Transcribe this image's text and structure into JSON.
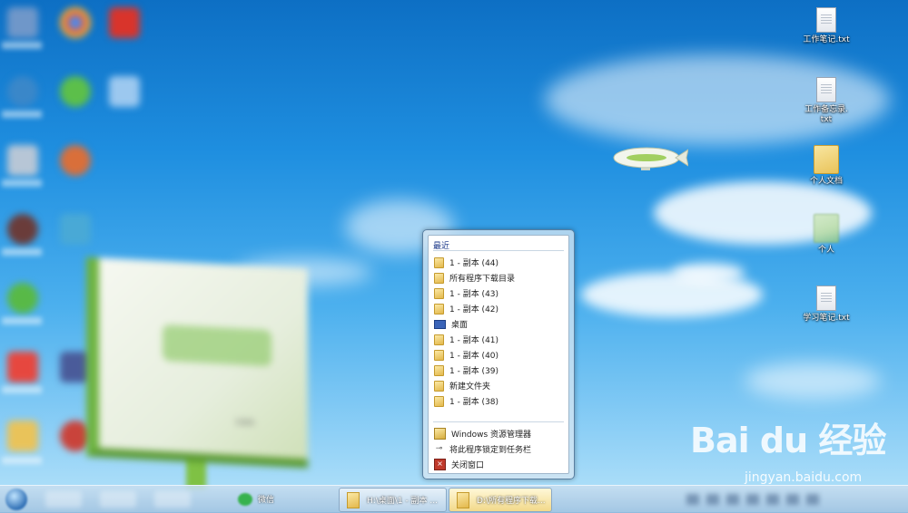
{
  "desktop_icons": [
    {
      "name": "工作笔记.txt",
      "type": "file"
    },
    {
      "name": "工作备忘录.\ntxt",
      "type": "file"
    },
    {
      "name": "个人文档",
      "type": "folder"
    },
    {
      "name": "个人",
      "type": "folder"
    },
    {
      "name": "学习笔记.txt",
      "type": "file"
    }
  ],
  "jumplist": {
    "header": "最近",
    "recent_items": [
      {
        "label": "1 - 副本 (44)",
        "icon": "folder-icon"
      },
      {
        "label": "所有程序下载目录",
        "icon": "folder-icon"
      },
      {
        "label": "1 - 副本 (43)",
        "icon": "folder-icon"
      },
      {
        "label": "1 - 副本 (42)",
        "icon": "folder-icon"
      },
      {
        "label": "桌面",
        "icon": "desktop-icon"
      },
      {
        "label": "1 - 副本 (41)",
        "icon": "folder-icon"
      },
      {
        "label": "1 - 副本 (40)",
        "icon": "folder-icon"
      },
      {
        "label": "1 - 副本 (39)",
        "icon": "folder-icon"
      },
      {
        "label": "新建文件夹",
        "icon": "folder-icon"
      },
      {
        "label": "1 - 副本 (38)",
        "icon": "folder-icon"
      }
    ],
    "tasks": {
      "explorer": "Windows 资源管理器",
      "pin": "将此程序锁定到任务栏",
      "close": "关闭窗口"
    }
  },
  "taskbar": {
    "wechat": "微信",
    "window1": "H:\\桌面\\1 - 副本 ...",
    "window2": "D:\\所有程序下载..."
  },
  "billboard": {
    "text": "com"
  },
  "watermark": {
    "logo": "Bai du 经验",
    "url": "jingyan.baidu.com"
  }
}
